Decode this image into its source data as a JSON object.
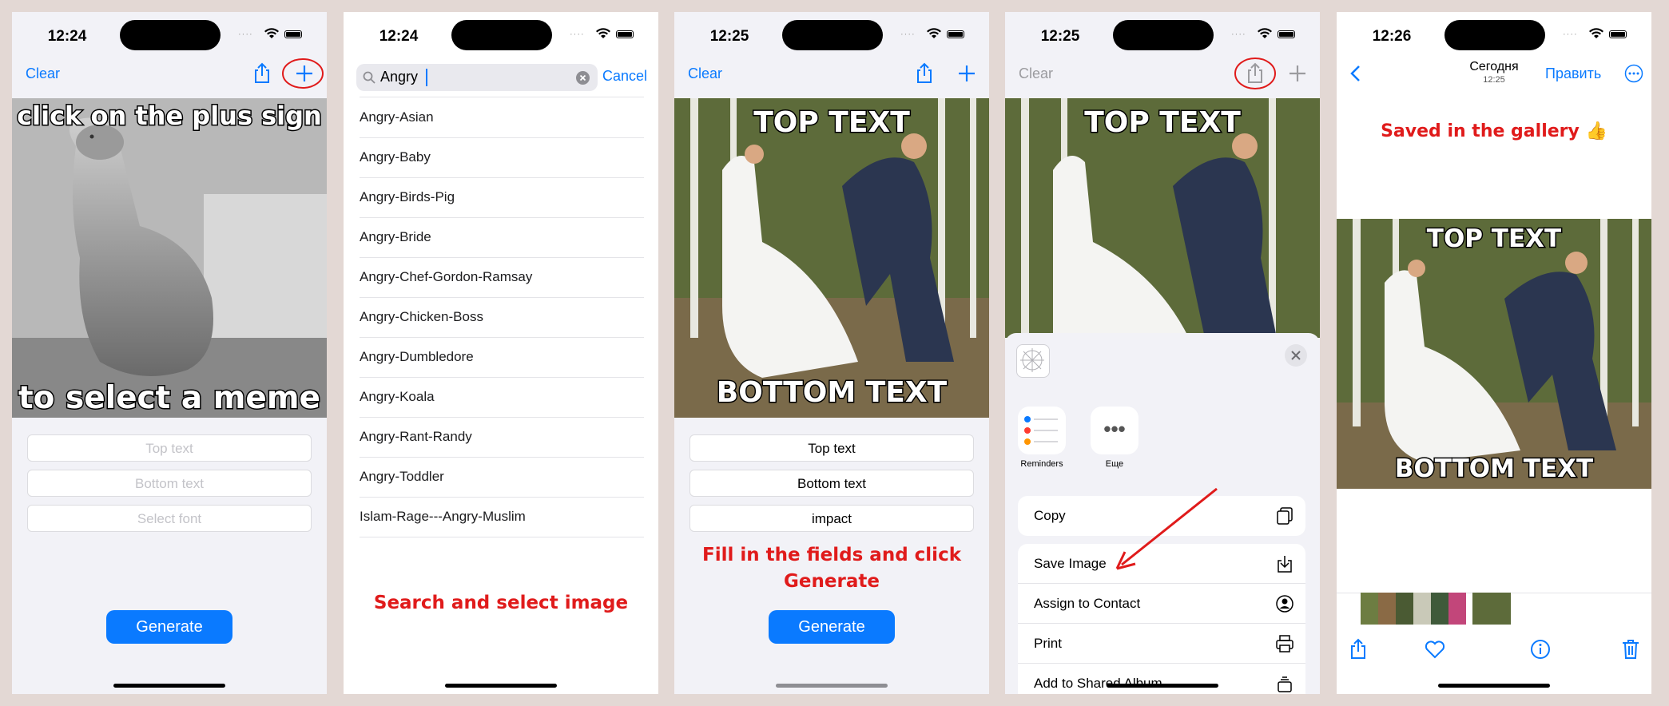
{
  "screens": [
    {
      "status_time": "12:24",
      "nav": {
        "clear": "Clear",
        "share_icon": "share-icon",
        "add_icon": "plus-icon"
      },
      "meme": {
        "top": "click on the plus sign",
        "bottom": "to select a meme"
      },
      "fields": {
        "top_placeholder": "Top text",
        "bottom_placeholder": "Bottom text",
        "font_placeholder": "Select font"
      },
      "generate": "Generate"
    },
    {
      "status_time": "12:24",
      "search": {
        "value": "Angry",
        "cancel": "Cancel"
      },
      "results": [
        "Angry-Asian",
        "Angry-Baby",
        "Angry-Birds-Pig",
        "Angry-Bride",
        "Angry-Chef-Gordon-Ramsay",
        "Angry-Chicken-Boss",
        "Angry-Dumbledore",
        "Angry-Koala",
        "Angry-Rant-Randy",
        "Angry-Toddler",
        "Islam-Rage---Angry-Muslim"
      ],
      "annotation": "Search and select image"
    },
    {
      "status_time": "12:25",
      "nav": {
        "clear": "Clear"
      },
      "meme": {
        "top": "TOP TEXT",
        "bottom": "BOTTOM TEXT"
      },
      "fields": {
        "top": "Top text",
        "bottom": "Bottom text",
        "font": "impact"
      },
      "annotation": "Fill in the fields and click Generate",
      "generate": "Generate"
    },
    {
      "status_time": "12:25",
      "nav": {
        "clear": "Clear"
      },
      "meme": {
        "top": "TOP TEXT"
      },
      "apps": [
        {
          "label": "Reminders"
        },
        {
          "label": "Еще"
        }
      ],
      "actions": [
        {
          "label": "Copy",
          "icon": "copy-icon"
        },
        {
          "label": "Save Image",
          "icon": "save-icon"
        },
        {
          "label": "Assign to Contact",
          "icon": "contact-icon"
        },
        {
          "label": "Print",
          "icon": "printer-icon"
        },
        {
          "label": "Add to Shared Album",
          "icon": "shared-album-icon"
        }
      ]
    },
    {
      "status_time": "12:26",
      "nav": {
        "title": "Сегодня",
        "subtitle": "12:25",
        "edit": "Править"
      },
      "annotation": "Saved in the gallery 👍",
      "meme": {
        "top": "TOP TEXT",
        "bottom": "BOTTOM TEXT"
      }
    }
  ],
  "colors": {
    "accent": "#0a7aff",
    "annotation": "#e01b1b",
    "background": "#e3d8d4"
  }
}
